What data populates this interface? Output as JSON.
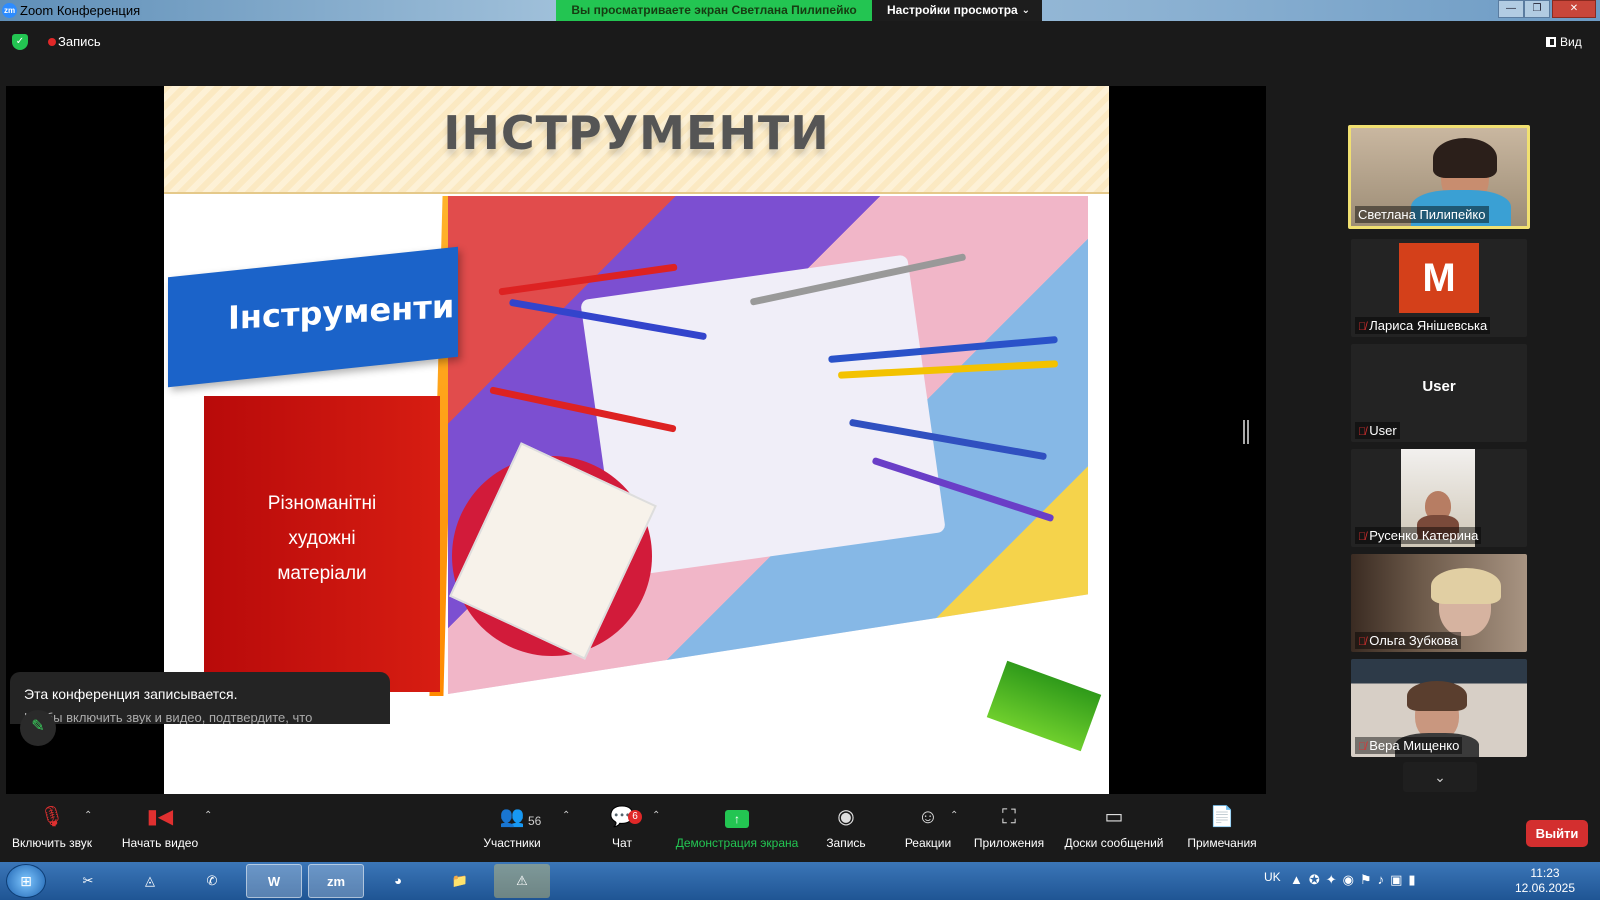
{
  "titlebar": {
    "app_title": "Zoom Конференция",
    "app_icon_label": "zm",
    "share_banner": "Вы просматриваете экран Светлана Пилипейко",
    "view_settings": "Настройки просмотра",
    "minimize": "—",
    "maximize": "❐",
    "close": "✕"
  },
  "meeting_bar": {
    "recording_label": "Запись",
    "view_label": "Вид"
  },
  "slide": {
    "title": "ІНСТРУМЕНТИ",
    "banner_text": "Інструменти",
    "red_box_lines": [
      "Різноманітні",
      "художні",
      "матеріали"
    ]
  },
  "toast": {
    "line1": "Эта конференция записывается.",
    "line2": "Чтобы включить звук и видео, подтвердите, что"
  },
  "participants": [
    {
      "name": "Светлана Пилипейко",
      "active": true,
      "muted": false
    },
    {
      "name": "Лариса Янішевська",
      "avatar": "М",
      "muted": true
    },
    {
      "name": "User",
      "avatar_text": "User",
      "muted": true
    },
    {
      "name": "Русенко Катерина",
      "muted": true
    },
    {
      "name": "Ольга Зубкова",
      "muted": true
    },
    {
      "name": "Вера Мищенко",
      "muted": true
    }
  ],
  "toolbar": {
    "unmute": "Включить звук",
    "start_video": "Начать видео",
    "participants": "Участники",
    "participants_count": "56",
    "chat": "Чат",
    "chat_badge": "6",
    "share_screen": "Демонстрация экрана",
    "record": "Запись",
    "reactions": "Реакции",
    "apps": "Приложения",
    "whiteboards": "Доски сообщений",
    "notes": "Примечания",
    "leave": "Выйти"
  },
  "taskbar": {
    "language": "UK",
    "time": "11:23",
    "date": "12.06.2025",
    "apps": [
      "tools",
      "avast",
      "viber",
      "word",
      "zoom",
      "chrome",
      "explorer",
      "warning"
    ]
  },
  "colors": {
    "green": "#23c552",
    "leave_red": "#d32f2f",
    "active_border": "#f1e071"
  }
}
